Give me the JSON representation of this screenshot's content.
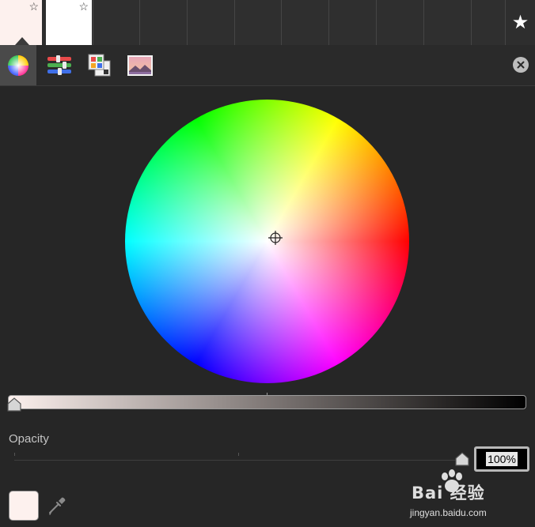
{
  "swatches": {
    "items": [
      {
        "color": "#fdf1ee",
        "starred": true,
        "selected": true
      },
      {
        "color": "#ffffff",
        "starred": true,
        "selected": false
      },
      {
        "color": "",
        "starred": false
      },
      {
        "color": "",
        "starred": false
      },
      {
        "color": "",
        "starred": false
      },
      {
        "color": "",
        "starred": false
      },
      {
        "color": "",
        "starred": false
      },
      {
        "color": "",
        "starred": false
      },
      {
        "color": "",
        "starred": false
      },
      {
        "color": "",
        "starred": false
      }
    ],
    "star_glyph": "☆",
    "favorites_glyph": "★"
  },
  "toolbar": {
    "modes": [
      {
        "name": "color-wheel-icon",
        "active": true
      },
      {
        "name": "color-sliders-icon",
        "active": false
      },
      {
        "name": "color-palettes-icon",
        "active": false
      },
      {
        "name": "image-palettes-icon",
        "active": false
      }
    ],
    "close_icon": "close-icon"
  },
  "color_wheel": {
    "selected_color": "#fdf1ee"
  },
  "brightness": {
    "level_percent": 0,
    "start_color": "#fdf1ee",
    "end_color": "#000000"
  },
  "opacity": {
    "label": "Opacity",
    "value_text": "100%",
    "level_percent": 100
  },
  "current_color": {
    "color": "#fdf1ee"
  },
  "watermark": {
    "brand": "Bai 经验",
    "url": "jingyan.baidu.com"
  }
}
